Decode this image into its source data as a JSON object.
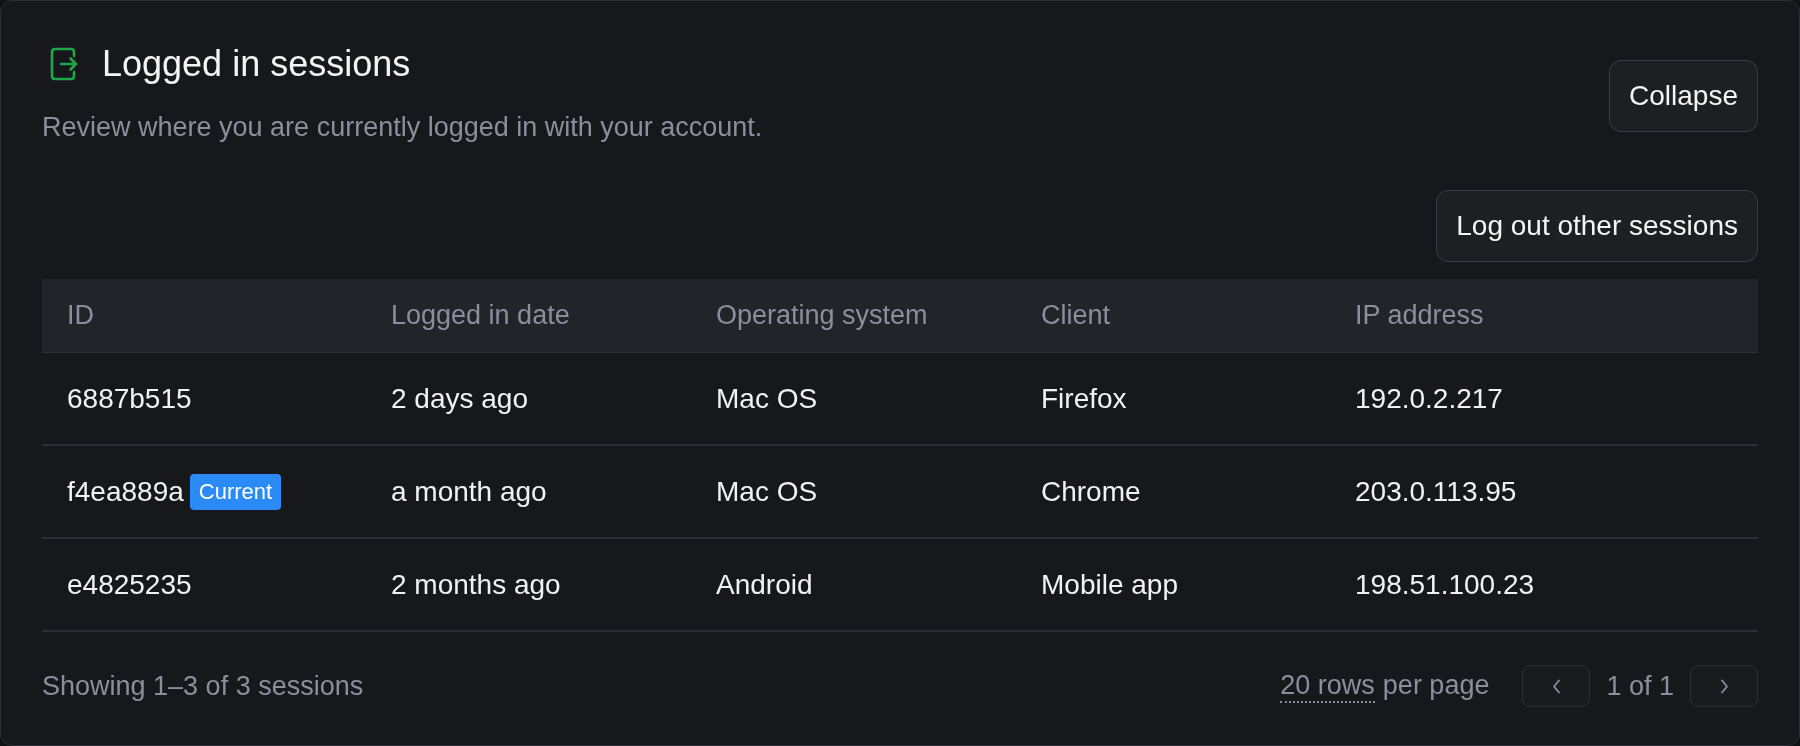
{
  "header": {
    "title": "Logged in sessions",
    "description": "Review where you are currently logged in with your account.",
    "button": "Collapse"
  },
  "actions": [
    {
      "label": "Log out other sessions"
    }
  ],
  "table": {
    "columns": [
      "ID",
      "Logged in date",
      "Operating system",
      "Client",
      "IP address"
    ],
    "rows": [
      {
        "cells": [
          "6887b515",
          "2 days ago",
          "Mac OS",
          "Firefox",
          "192.0.2.217"
        ]
      },
      {
        "cells": [
          "f4ea889a",
          "a month ago",
          "Mac OS",
          "Chrome",
          "203.0.113.95"
        ],
        "badge": "Current"
      },
      {
        "cells": [
          "e4825235",
          "2 months ago",
          "Android",
          "Mobile app",
          "198.51.100.23"
        ]
      }
    ]
  },
  "footer": {
    "summary": "Showing 1–3 of 3 sessions",
    "rows_per_page": "20 rows",
    "rows_per_page_label": "per page",
    "page": "1 of 1",
    "pager": [
      {
        "kind": "previous",
        "disabled": true
      },
      {
        "kind": "next",
        "disabled": true
      }
    ]
  }
}
